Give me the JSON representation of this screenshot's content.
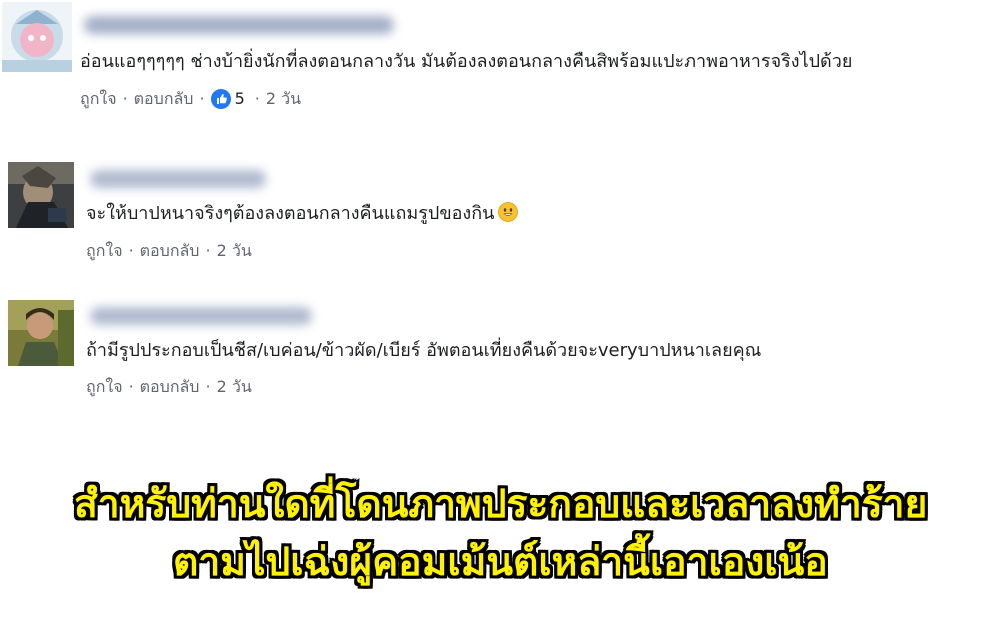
{
  "comments": [
    {
      "text": "อ่อนแอๆๆๆๆๆ ช่างบ้ายิ่งนักที่ลงตอนกลางวัน มันต้องลงตอนกลางคืนสิพร้อมแปะภาพอาหารจริงไปด้วย",
      "like_label": "ถูกใจ",
      "reply_label": "ตอบกลับ",
      "like_count": "5",
      "time": "2 วัน",
      "reaction_icon": "thumbs-up-icon"
    },
    {
      "text": "จะให้บาปหนาจริงๆต้องลงตอนกลางคืนแถมรูปของกิน",
      "emoji_icon": "smiley-emoji-icon",
      "like_label": "ถูกใจ",
      "reply_label": "ตอบกลับ",
      "time": "2 วัน"
    },
    {
      "text": "ถ้ามีรูปประกอบเป็นชีส/เบค่อน/ข้าวผัด/เบียร์ อัพตอนเที่ยงคืนด้วยจะveryบาปหนาเลยคุณ",
      "like_label": "ถูกใจ",
      "reply_label": "ตอบกลับ",
      "time": "2 วัน"
    }
  ],
  "caption": {
    "line1": "สำหรับท่านใดที่โดนภาพประกอบและเวลาลงทำร้าย",
    "line2": "ตามไปเฉ่งผู้คอมเม้นต์เหล่านี้เอาเองเน้อ"
  },
  "colors": {
    "link_gray": "#606770",
    "text_dark": "#1c1e21",
    "like_blue": "#2078f4",
    "caption_yellow": "#fff200",
    "caption_outline": "#000000"
  }
}
